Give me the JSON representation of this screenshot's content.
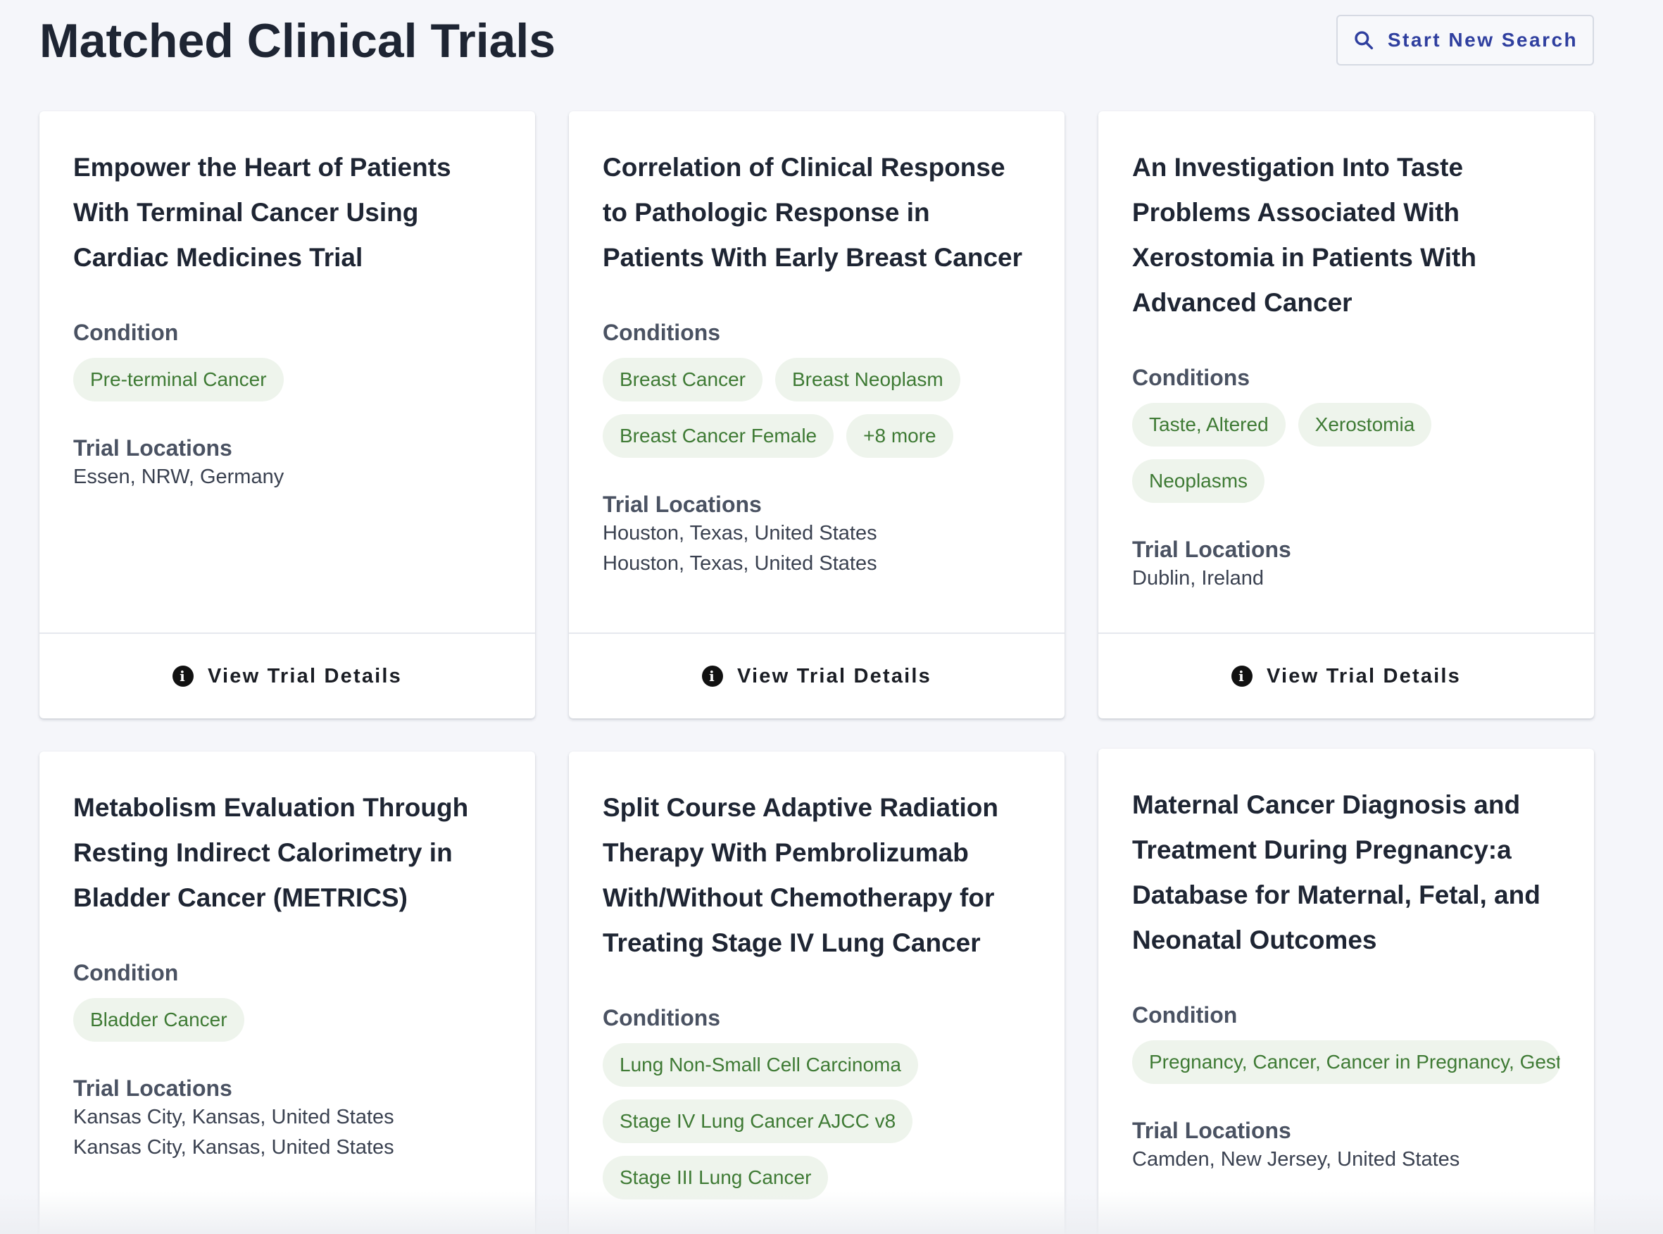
{
  "header": {
    "title": "Matched Clinical Trials",
    "search_button_label": "Start New Search",
    "search_icon": "search-icon"
  },
  "labels": {
    "condition_singular": "Condition",
    "condition_plural": "Conditions",
    "trial_locations": "Trial Locations",
    "view_details": "View Trial Details",
    "info_icon": "info-icon"
  },
  "colors": {
    "title": "#1e2533",
    "button_text": "#2f3f9f",
    "chip_bg": "#eef4ec",
    "chip_text": "#3e7a34",
    "background": "#f5f6fa"
  },
  "trials": [
    {
      "title": "Empower the Heart of Patients With Terminal Cancer Using Cardiac Medicines Trial",
      "condition_label": "Condition",
      "conditions": [
        "Pre-terminal Cancer"
      ],
      "locations": [
        "Essen, NRW, Germany"
      ]
    },
    {
      "title": "Correlation of Clinical Response to Pathologic Response in Patients With Early Breast Cancer",
      "condition_label": "Conditions",
      "conditions": [
        "Breast Cancer",
        "Breast Neoplasm",
        "Breast Cancer Female",
        "+8 more"
      ],
      "locations": [
        "Houston, Texas, United States",
        "Houston, Texas, United States"
      ]
    },
    {
      "title": "An Investigation Into Taste Problems Associated With Xerostomia in Patients With Advanced Cancer",
      "condition_label": "Conditions",
      "conditions": [
        "Taste, Altered",
        "Xerostomia",
        "Neoplasms"
      ],
      "locations": [
        "Dublin, Ireland"
      ]
    },
    {
      "title": "Metabolism Evaluation Through Resting Indirect Calorimetry in Bladder Cancer (METRICS)",
      "condition_label": "Condition",
      "conditions": [
        "Bladder Cancer"
      ],
      "locations": [
        "Kansas City, Kansas, United States",
        "Kansas City, Kansas, United States"
      ]
    },
    {
      "title": "Split Course Adaptive Radiation Therapy With Pembrolizumab With/Without Chemotherapy for Treating Stage IV Lung Cancer",
      "condition_label": "Conditions",
      "conditions": [
        "Lung Non-Small Cell Carcinoma",
        "Stage IV Lung Cancer AJCC v8",
        "Stage III Lung Cancer"
      ],
      "locations": []
    },
    {
      "title": "Maternal Cancer Diagnosis and Treatment During Pregnancy:a Database for Maternal, Fetal, and Neonatal Outcomes",
      "condition_label": "Condition",
      "conditions": [
        "Pregnancy, Cancer, Cancer in Pregnancy, Gest"
      ],
      "locations": [
        "Camden, New Jersey, United States"
      ]
    }
  ]
}
